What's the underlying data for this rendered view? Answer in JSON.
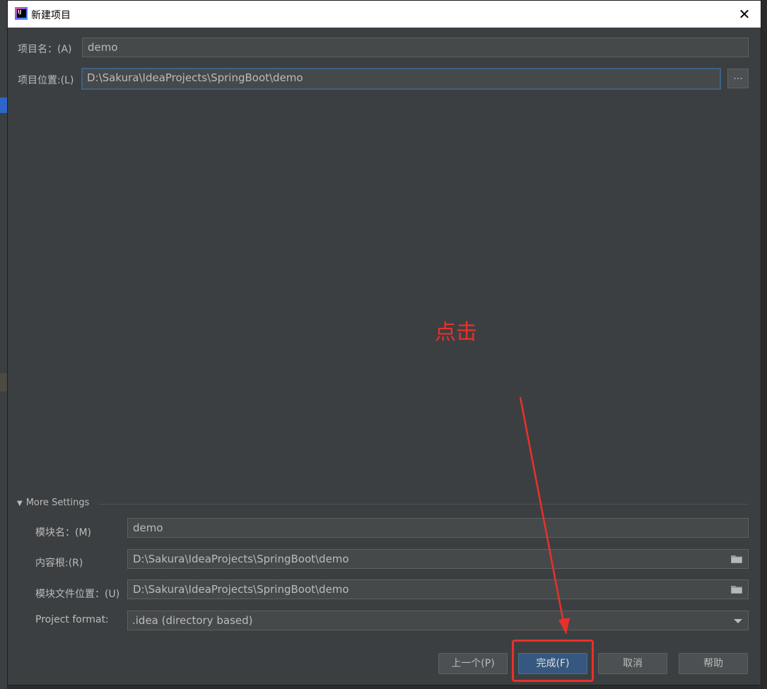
{
  "window": {
    "title": "新建项目",
    "close_symbol": "✕"
  },
  "project": {
    "name_label": "项目名：(A)",
    "name_value": "demo",
    "location_label": "项目位置:(L)",
    "location_value": "D:\\Sakura\\IdeaProjects\\SpringBoot\\demo",
    "browse_label": "..."
  },
  "annotation": {
    "text": "点击",
    "color": "#e8312a"
  },
  "more_settings": {
    "header": "More Settings",
    "module_name_label": "模块名：(M)",
    "module_name_value": "demo",
    "content_root_label": "内容根:(R)",
    "content_root_value": "D:\\Sakura\\IdeaProjects\\SpringBoot\\demo",
    "module_file_label": "模块文件位置：(U)",
    "module_file_value": "D:\\Sakura\\IdeaProjects\\SpringBoot\\demo",
    "format_label": "Project format:",
    "format_value": ".idea (directory based)"
  },
  "buttons": {
    "previous": "上一个(P)",
    "finish": "完成(F)",
    "cancel": "取消",
    "help": "帮助"
  },
  "icons": [
    "intellij-app-icon",
    "close-icon",
    "folder-icon",
    "chevron-down-icon",
    "collapse-triangle-icon"
  ]
}
